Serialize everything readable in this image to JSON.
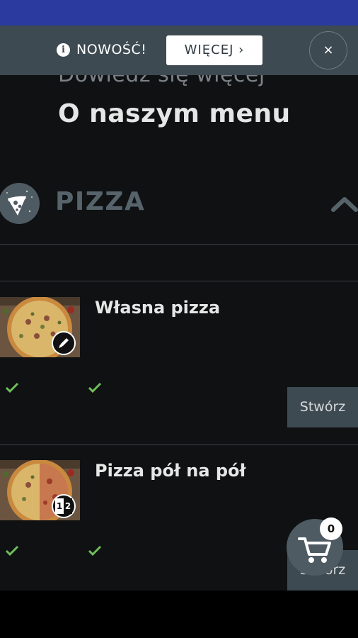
{
  "notice": {
    "info_icon": "i",
    "text": "NOWOŚĆ!",
    "more_label": "WIĘCEJ ›",
    "close_label": "×"
  },
  "intro": {
    "subtitle": "Dowiedz się więcej",
    "title": "O naszym menu"
  },
  "category": {
    "name": "PIZZA",
    "icon": "pizza-slice-icon",
    "expanded": true
  },
  "products": [
    {
      "name": "Własna pizza",
      "badge": "pencil-icon",
      "button_label": "Stwórz"
    },
    {
      "name": "Pizza pół na pół",
      "badge_digits": [
        "1",
        "2"
      ],
      "button_label": "Stwórz"
    }
  ],
  "cart": {
    "count": "0",
    "icon": "shopping-cart-icon"
  },
  "colors": {
    "status_bar": "#2b3a9f",
    "notice_bar": "#3d4a52",
    "background": "#0f1112",
    "check": "#6fbf5a",
    "accent": "#4e5b63"
  }
}
